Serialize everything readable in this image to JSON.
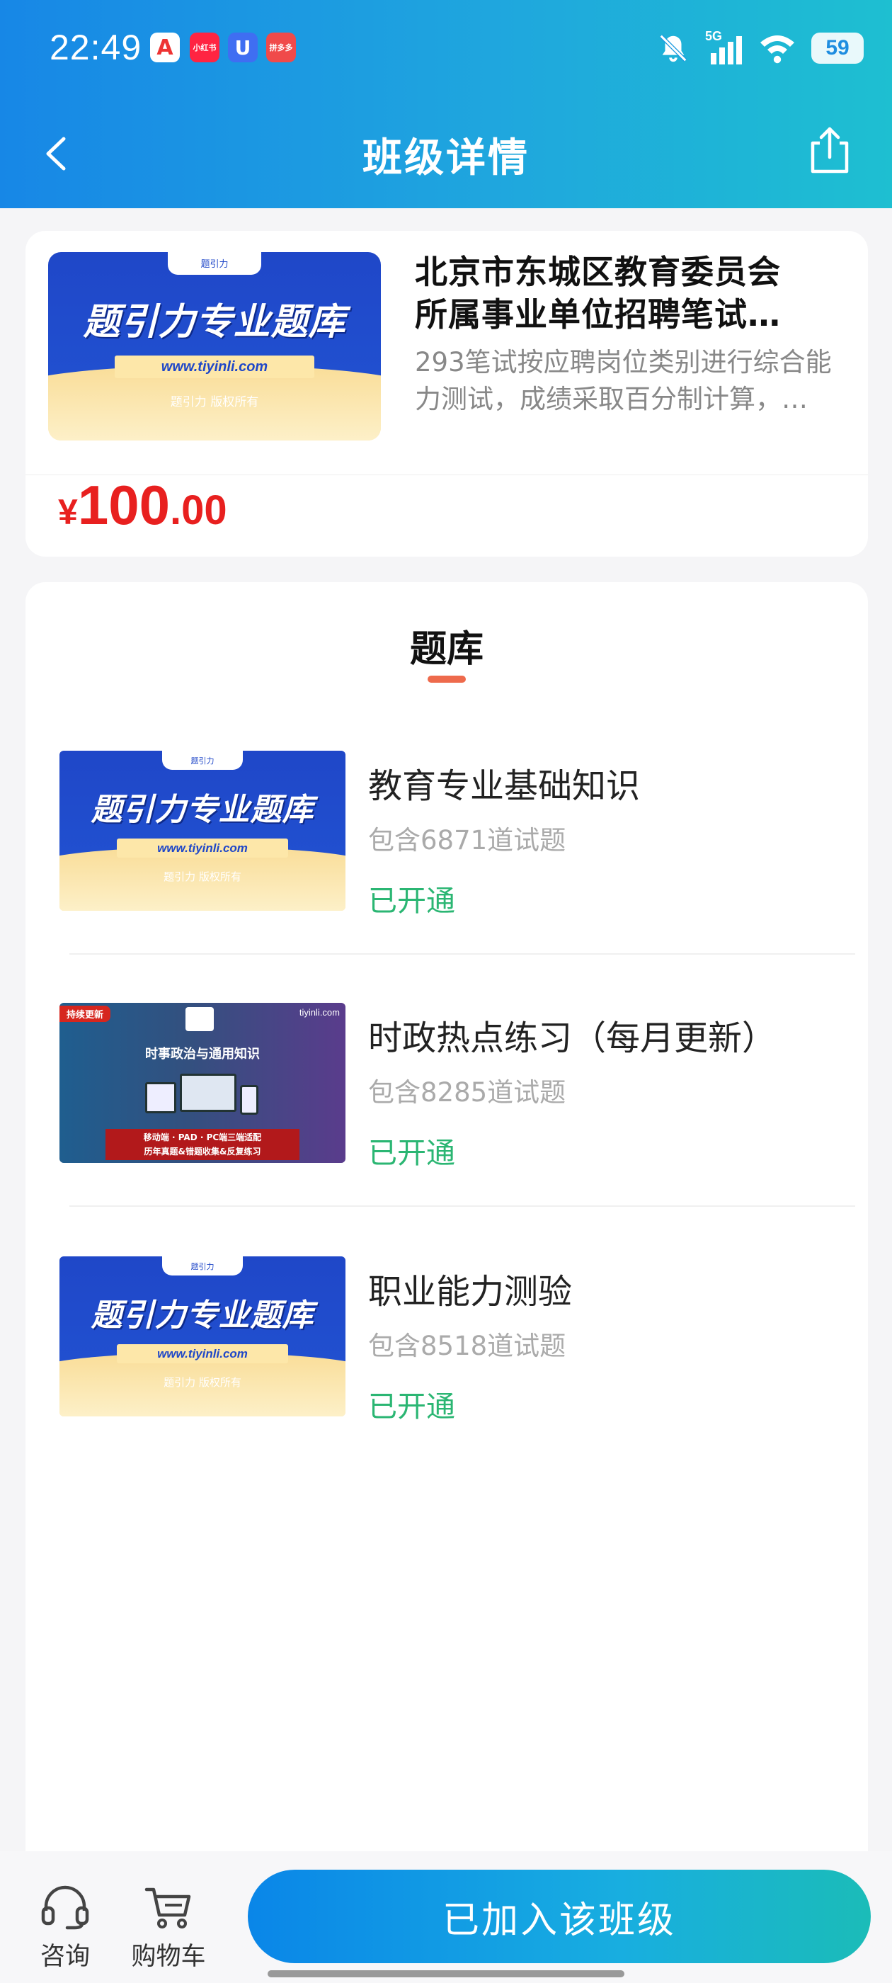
{
  "status_bar": {
    "time": "22:49",
    "app_icons": [
      "A",
      "小红书",
      "U",
      "拼多多"
    ],
    "network": "5G",
    "battery": "59"
  },
  "nav": {
    "title": "班级详情",
    "back_icon": "chevron-left-icon",
    "share_icon": "share-icon"
  },
  "class_card": {
    "cover": {
      "tab": "题引力",
      "title": "题引力专业题库",
      "url": "www.tiyinli.com",
      "copyright": "题引力 版权所有"
    },
    "title_line1": "北京市东城区教育委员会",
    "title_line2": "所属事业单位招聘笔试…",
    "desc_line1": "293笔试按应聘岗位类别进行综合能",
    "desc_line2": "力测试，成绩采取百分制计算，…",
    "price_symbol": "¥",
    "price_int": "100",
    "price_dec": ".00"
  },
  "bank": {
    "section_title": "题库",
    "items": [
      {
        "name": "教育专业基础知识",
        "count": "包含6871道试题",
        "status": "已开通",
        "cover": {
          "tab": "题引力",
          "title": "题引力专业题库",
          "url": "www.tiyinli.com",
          "copyright": "题引力 版权所有"
        }
      },
      {
        "name": "时政热点练习（每月更新）",
        "count": "包含8285道试题",
        "status": "已开通",
        "cover": {
          "badge": "持续更新",
          "site": "tiyinli.com",
          "title": "时事政治与通用知识",
          "banner_line1": "移动端 · PAD · PC端三端适配",
          "banner_line2": "历年真题&错题收集&反复练习"
        }
      },
      {
        "name": "职业能力测验",
        "count": "包含8518道试题",
        "status": "已开通",
        "cover": {
          "tab": "题引力",
          "title": "题引力专业题库",
          "url": "www.tiyinli.com",
          "copyright": "题引力 版权所有"
        }
      }
    ]
  },
  "bottom_bar": {
    "consult_label": "咨询",
    "cart_label": "购物车",
    "join_label": "已加入该班级"
  },
  "colors": {
    "header_start": "#1787e6",
    "header_end": "#1ebfd1",
    "price": "#e8201f",
    "status_green": "#2bb673",
    "tab_underline": "#ee6a4c"
  }
}
